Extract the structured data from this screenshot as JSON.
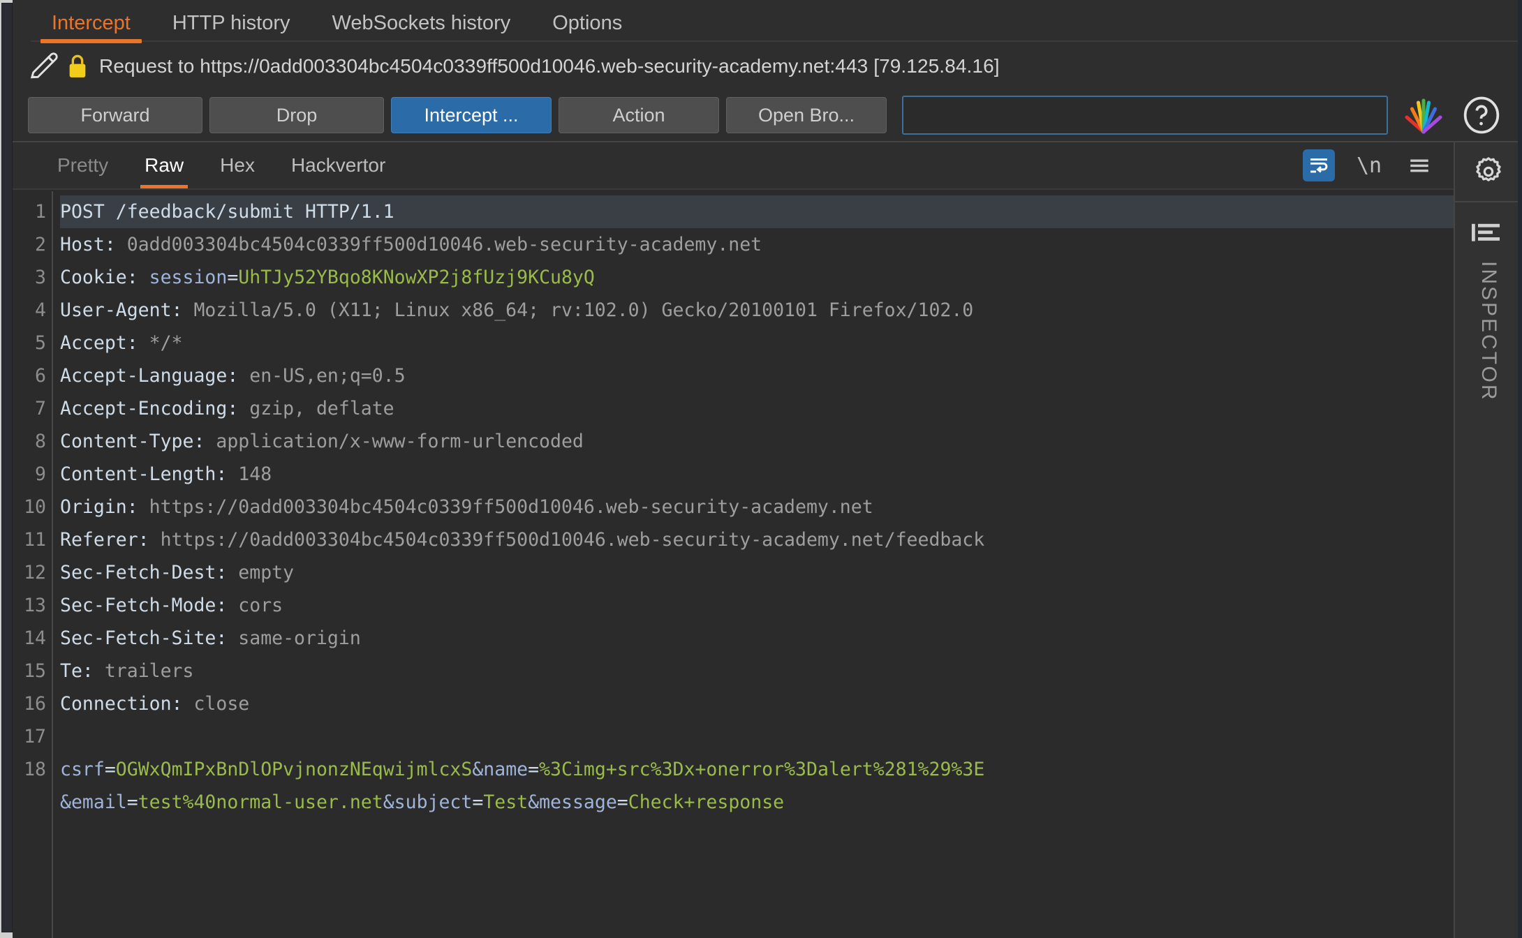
{
  "window": {
    "top_tabs": [
      {
        "label": "Intercept",
        "active": true
      },
      {
        "label": "HTTP history",
        "active": false
      },
      {
        "label": "WebSockets history",
        "active": false
      },
      {
        "label": "Options",
        "active": false
      }
    ]
  },
  "request_bar": {
    "pencil_icon": "pencil-icon",
    "lock_icon": "lock-icon",
    "text": "Request to https://0add003304bc4504c0339ff500d10046.web-security-academy.net:443 [79.125.84.16]"
  },
  "actions": {
    "forward": "Forward",
    "drop": "Drop",
    "intercept_toggle": "Intercept ...",
    "action": "Action",
    "open_browser": "Open Bro...",
    "search_value": "",
    "search_placeholder": "",
    "burp_logo_icon": "burp-rainbow-logo-icon",
    "help_icon": "help-circle-icon"
  },
  "editor": {
    "tabs": [
      {
        "label": "Pretty",
        "state": "dim"
      },
      {
        "label": "Raw",
        "state": "active"
      },
      {
        "label": "Hex",
        "state": "normal"
      },
      {
        "label": "Hackvertor",
        "state": "normal"
      }
    ],
    "tools": [
      {
        "name": "word-wrap-icon",
        "glyph": "≡",
        "selected": true
      },
      {
        "name": "newline-icon",
        "glyph": "\\n",
        "selected": false
      },
      {
        "name": "hamburger-menu-icon",
        "glyph": "☰",
        "selected": false
      }
    ],
    "line_numbers": [
      "1",
      "2",
      "3",
      "4",
      "5",
      "6",
      "7",
      "8",
      "9",
      "10",
      "11",
      "12",
      "13",
      "14",
      "15",
      "16",
      "17",
      "18",
      ""
    ],
    "lines": [
      {
        "n": 1,
        "highlight": true,
        "segments": [
          {
            "t": "POST /feedback/submit HTTP/1.1",
            "c": "hname"
          }
        ]
      },
      {
        "n": 2,
        "highlight": false,
        "segments": [
          {
            "t": "Host: ",
            "c": "hname"
          },
          {
            "t": "0add003304bc4504c0339ff500d10046.web-security-academy.net",
            "c": "hval"
          }
        ]
      },
      {
        "n": 3,
        "highlight": false,
        "segments": [
          {
            "t": "Cookie: ",
            "c": "hname"
          },
          {
            "t": "session",
            "c": "pname"
          },
          {
            "t": "=",
            "c": "eq"
          },
          {
            "t": "UhTJy52YBqo8KNowXP2j8fUzj9KCu8yQ",
            "c": "pval"
          }
        ]
      },
      {
        "n": 4,
        "highlight": false,
        "segments": [
          {
            "t": "User-Agent: ",
            "c": "hname"
          },
          {
            "t": "Mozilla/5.0 (X11; Linux x86_64; rv:102.0) Gecko/20100101 Firefox/102.0",
            "c": "hval"
          }
        ]
      },
      {
        "n": 5,
        "highlight": false,
        "segments": [
          {
            "t": "Accept: ",
            "c": "hname"
          },
          {
            "t": "*/*",
            "c": "hval"
          }
        ]
      },
      {
        "n": 6,
        "highlight": false,
        "segments": [
          {
            "t": "Accept-Language: ",
            "c": "hname"
          },
          {
            "t": "en-US,en;q=0.5",
            "c": "hval"
          }
        ]
      },
      {
        "n": 7,
        "highlight": false,
        "segments": [
          {
            "t": "Accept-Encoding: ",
            "c": "hname"
          },
          {
            "t": "gzip, deflate",
            "c": "hval"
          }
        ]
      },
      {
        "n": 8,
        "highlight": false,
        "segments": [
          {
            "t": "Content-Type: ",
            "c": "hname"
          },
          {
            "t": "application/x-www-form-urlencoded",
            "c": "hval"
          }
        ]
      },
      {
        "n": 9,
        "highlight": false,
        "segments": [
          {
            "t": "Content-Length: ",
            "c": "hname"
          },
          {
            "t": "148",
            "c": "hval"
          }
        ]
      },
      {
        "n": 10,
        "highlight": false,
        "segments": [
          {
            "t": "Origin: ",
            "c": "hname"
          },
          {
            "t": "https://0add003304bc4504c0339ff500d10046.web-security-academy.net",
            "c": "hval"
          }
        ]
      },
      {
        "n": 11,
        "highlight": false,
        "segments": [
          {
            "t": "Referer: ",
            "c": "hname"
          },
          {
            "t": "https://0add003304bc4504c0339ff500d10046.web-security-academy.net/feedback",
            "c": "hval"
          }
        ]
      },
      {
        "n": 12,
        "highlight": false,
        "segments": [
          {
            "t": "Sec-Fetch-Dest: ",
            "c": "hname"
          },
          {
            "t": "empty",
            "c": "hval"
          }
        ]
      },
      {
        "n": 13,
        "highlight": false,
        "segments": [
          {
            "t": "Sec-Fetch-Mode: ",
            "c": "hname"
          },
          {
            "t": "cors",
            "c": "hval"
          }
        ]
      },
      {
        "n": 14,
        "highlight": false,
        "segments": [
          {
            "t": "Sec-Fetch-Site: ",
            "c": "hname"
          },
          {
            "t": "same-origin",
            "c": "hval"
          }
        ]
      },
      {
        "n": 15,
        "highlight": false,
        "segments": [
          {
            "t": "Te: ",
            "c": "hname"
          },
          {
            "t": "trailers",
            "c": "hval"
          }
        ]
      },
      {
        "n": 16,
        "highlight": false,
        "segments": [
          {
            "t": "Connection: ",
            "c": "hname"
          },
          {
            "t": "close",
            "c": "hval"
          }
        ]
      },
      {
        "n": 17,
        "highlight": false,
        "segments": [
          {
            "t": "",
            "c": "hname"
          }
        ]
      },
      {
        "n": 18,
        "highlight": false,
        "segments": [
          {
            "t": "csrf",
            "c": "pname"
          },
          {
            "t": "=",
            "c": "eq"
          },
          {
            "t": "OGWxQmIPxBnDlOPvjnonzNEqwijmlcxS",
            "c": "pval"
          },
          {
            "t": "&name",
            "c": "pname"
          },
          {
            "t": "=",
            "c": "eq"
          },
          {
            "t": "%3Cimg+src%3Dx+onerror%3Dalert%281%29%3E",
            "c": "pval"
          }
        ]
      },
      {
        "n": "",
        "highlight": false,
        "segments": [
          {
            "t": "&email",
            "c": "pname"
          },
          {
            "t": "=",
            "c": "eq"
          },
          {
            "t": "test%40normal-user.net",
            "c": "pval"
          },
          {
            "t": "&subject",
            "c": "pname"
          },
          {
            "t": "=",
            "c": "eq"
          },
          {
            "t": "Test",
            "c": "pval"
          },
          {
            "t": "&message",
            "c": "pname"
          },
          {
            "t": "=",
            "c": "eq"
          },
          {
            "t": "Check+response",
            "c": "pval"
          }
        ]
      }
    ]
  },
  "inspector": {
    "gear_icon": "gear-icon",
    "panel_icon": "inspector-panel-icon",
    "label": "INSPECTOR"
  },
  "colors": {
    "accent_orange": "#e8752c",
    "accent_blue": "#2a6ba8",
    "bg": "#2b2b2b",
    "param_green": "#9aba4a",
    "param_blue": "#9fb4d8"
  }
}
